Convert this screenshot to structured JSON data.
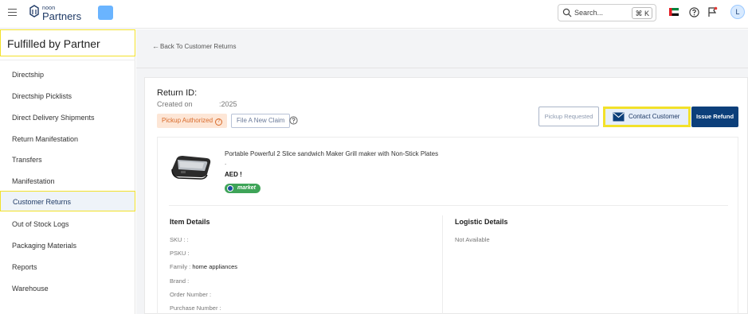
{
  "header": {
    "brand_small": "noon",
    "brand": "Partners",
    "search_placeholder": "Search...",
    "shortcut": "⌘ K",
    "avatar_initial": "L"
  },
  "sidebar": {
    "title": "Fulfilled by Partner",
    "items": [
      {
        "label": "Directship"
      },
      {
        "label": "Directship Picklists"
      },
      {
        "label": "Direct Delivery Shipments"
      },
      {
        "label": "Return Manifestation"
      },
      {
        "label": "Transfers"
      },
      {
        "label": "Manifestation"
      },
      {
        "label": "Customer Returns"
      },
      {
        "label": "Out of Stock Logs"
      },
      {
        "label": "Packaging Materials"
      },
      {
        "label": "Reports"
      },
      {
        "label": "Warehouse"
      }
    ],
    "active_index": 6
  },
  "main": {
    "back_label": "Back To Customer Returns",
    "return_id_label": "Return ID:",
    "created_label": "Created on",
    "created_date": ":2025",
    "status_badge": "Pickup Authorized",
    "claim_button": "File A New Claim",
    "pickup_button": "Pickup Requested",
    "contact_button": "Contact Customer",
    "refund_button": "Issue Refund",
    "product": {
      "title": "Portable Powerful 2 Slice sandwich Maker Grill maker with Non-Stick Plates",
      "dot": ".",
      "price": "AED !",
      "badge": "market"
    },
    "item_details": {
      "heading": "Item Details",
      "rows": [
        {
          "label": "SKU : :",
          "value": ""
        },
        {
          "label": "PSKU :",
          "value": ""
        },
        {
          "label": "Family : ",
          "value": "home appliances"
        },
        {
          "label": "Brand :",
          "value": ""
        },
        {
          "label": "Order Number :",
          "value": ""
        },
        {
          "label": "Purchase Number :",
          "value": ""
        }
      ]
    },
    "logistic_details": {
      "heading": "Logistic Details",
      "value": "Not Available"
    }
  },
  "colors": {
    "highlight": "#f2e12a",
    "primary": "#0c3f7a",
    "badge_bg": "#fde6d6",
    "badge_text": "#d86a2a",
    "market": "#3ea458"
  }
}
